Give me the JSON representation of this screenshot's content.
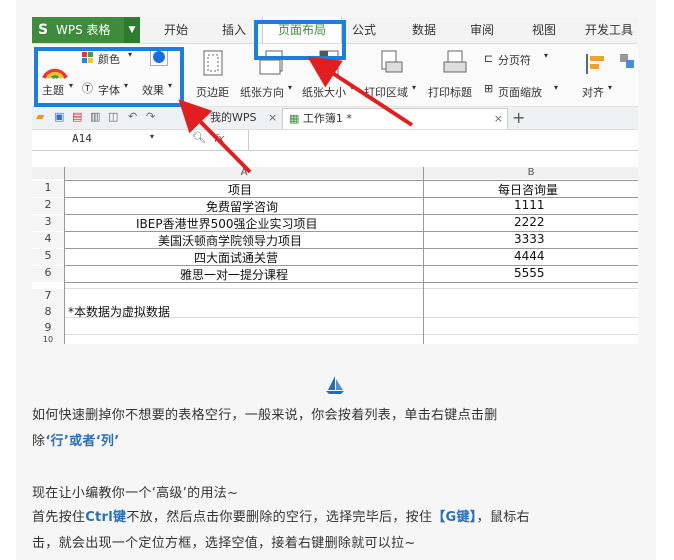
{
  "app": {
    "name": "WPS 表格",
    "menu_tabs": [
      "开始",
      "插入",
      "页面布局",
      "公式",
      "数据",
      "审阅",
      "视图",
      "开发工具"
    ],
    "active_tab": "页面布局",
    "accent": "#3e8b3e",
    "annotation_color": "#1f7fd8",
    "arrow_color": "#e02020"
  },
  "ribbon": {
    "color_label": "颜色",
    "theme_label": "主题",
    "font_label": "字体",
    "effect_label": "效果",
    "margin_label": "页边距",
    "orientation_label": "纸张方向",
    "size_label": "纸张大小",
    "print_area_label": "打印区域",
    "print_title_label": "打印标题",
    "page_break_label": "分页符",
    "page_zoom_label": "页面缩放",
    "align_label": "对齐"
  },
  "doc_tabs": {
    "tab1": "我的WPS",
    "tab2": "工作簿1 *"
  },
  "formula": {
    "cell_ref": "A14",
    "fx": "fx"
  },
  "sheet": {
    "col_a": "A",
    "col_b": "B",
    "rows": [
      {
        "num": "1",
        "a": "项目",
        "b": "每日咨询量"
      },
      {
        "num": "2",
        "a": "免费留学咨询",
        "b": "1111"
      },
      {
        "num": "3",
        "a": "IBEP香港世界500强企业实习项目",
        "b": "2222"
      },
      {
        "num": "4",
        "a": "美国沃顿商学院领导力项目",
        "b": "3333"
      },
      {
        "num": "5",
        "a": "四大面试通关营",
        "b": "4444"
      },
      {
        "num": "6",
        "a": "雅思一对一提分课程",
        "b": "5555"
      },
      {
        "num": "7",
        "a": "",
        "b": ""
      },
      {
        "num": "8",
        "a": "*本数据为虚拟数据",
        "b": ""
      },
      {
        "num": "9",
        "a": "",
        "b": ""
      },
      {
        "num": "10",
        "a": "",
        "b": ""
      }
    ]
  },
  "article": {
    "p1a": "如何快速删掉你不想要的表格空行，一般来说，你会按着列表，单击右键点击删",
    "p1b_prefix": "除",
    "p1b_hl": "‘行’或者‘列’",
    "p2": "现在让小编教你一个‘高级’的用法~",
    "p3_a": "首先按住",
    "p3_hl1": "Ctrl键",
    "p3_b": "不放，然后点击你要删除的空行，选择完毕后，按住",
    "p3_hl2": "【G键】",
    "p3_c": "，鼠标右",
    "p4": "击，就会出现一个定位方框，选择空值，接着右键删除就可以拉~"
  }
}
